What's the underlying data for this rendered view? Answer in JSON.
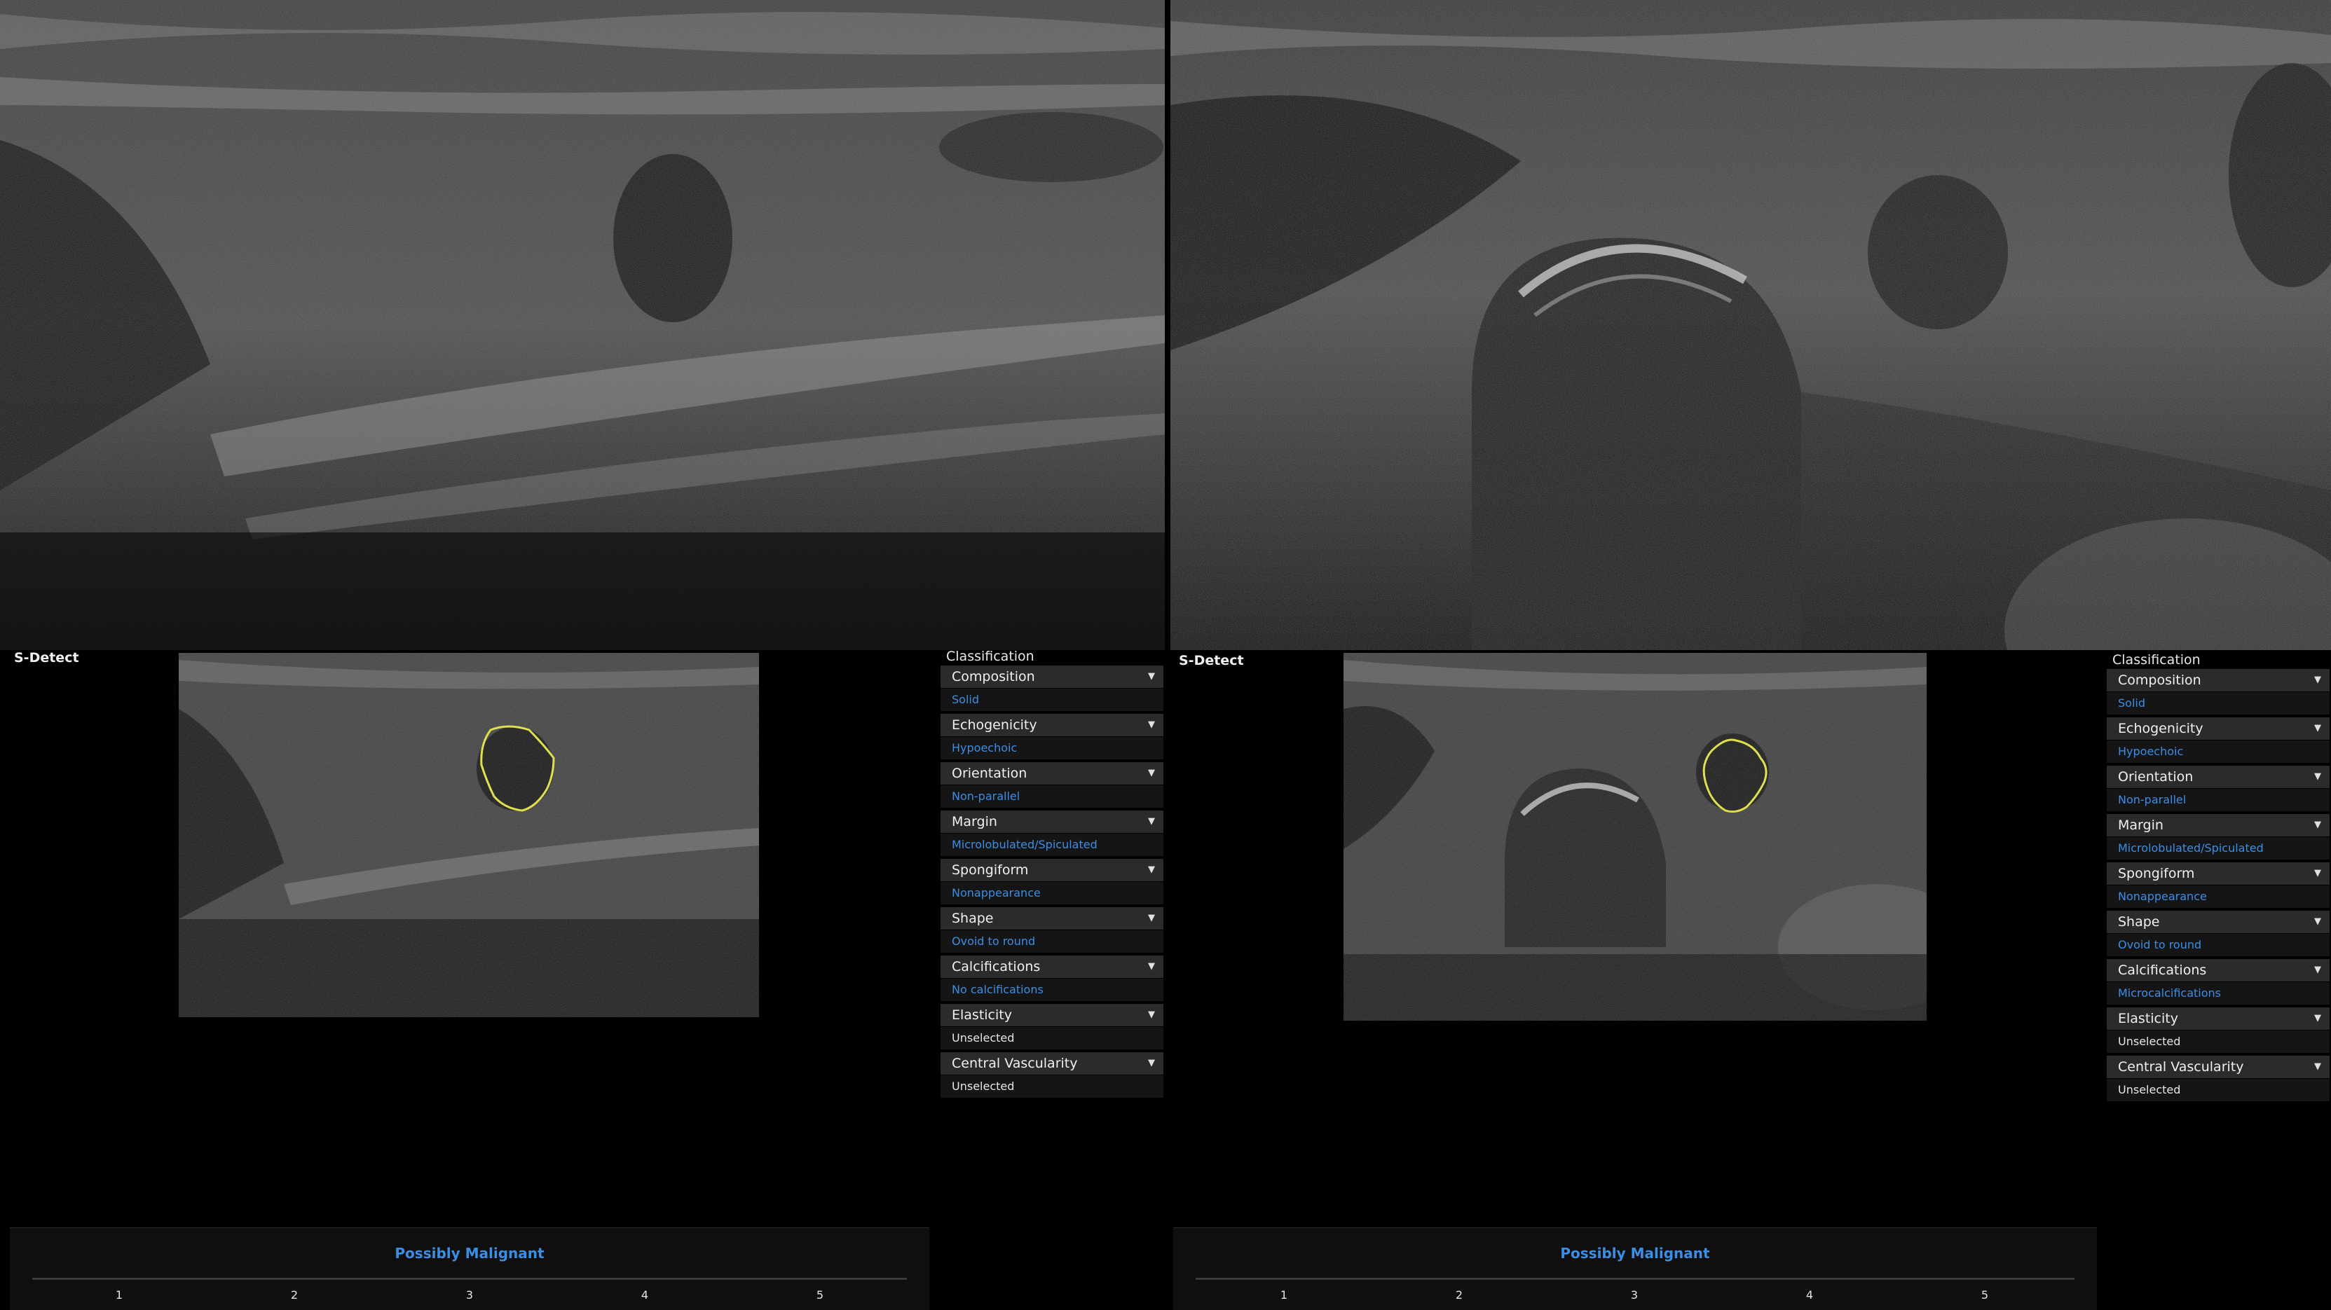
{
  "screens": [
    {
      "sdetect_label": "S-Detect",
      "classification_title": "Classification",
      "categories": [
        {
          "name": "Composition",
          "value": "Solid",
          "state": "set"
        },
        {
          "name": "Echogenicity",
          "value": "Hypoechoic",
          "state": "set"
        },
        {
          "name": "Orientation",
          "value": "Non-parallel",
          "state": "set"
        },
        {
          "name": "Margin",
          "value": "Microlobulated/Spiculated",
          "state": "set"
        },
        {
          "name": "Spongiform",
          "value": "Nonappearance",
          "state": "set"
        },
        {
          "name": "Shape",
          "value": "Ovoid to round",
          "state": "set"
        },
        {
          "name": "Calcifications",
          "value": "No calcifications",
          "state": "set"
        },
        {
          "name": "Elasticity",
          "value": "Unselected",
          "state": "unset"
        },
        {
          "name": "Central Vascularity",
          "value": "Unselected",
          "state": "unset"
        }
      ],
      "result_label": "Possibly Malignant",
      "scale": [
        "1",
        "2",
        "3",
        "4",
        "5"
      ]
    },
    {
      "sdetect_label": "S-Detect",
      "classification_title": "Classification",
      "categories": [
        {
          "name": "Composition",
          "value": "Solid",
          "state": "set"
        },
        {
          "name": "Echogenicity",
          "value": "Hypoechoic",
          "state": "set"
        },
        {
          "name": "Orientation",
          "value": "Non-parallel",
          "state": "set"
        },
        {
          "name": "Margin",
          "value": "Microlobulated/Spiculated",
          "state": "set"
        },
        {
          "name": "Spongiform",
          "value": "Nonappearance",
          "state": "set"
        },
        {
          "name": "Shape",
          "value": "Ovoid to round",
          "state": "set"
        },
        {
          "name": "Calcifications",
          "value": "Microcalcifications",
          "state": "set"
        },
        {
          "name": "Elasticity",
          "value": "Unselected",
          "state": "unset"
        },
        {
          "name": "Central Vascularity",
          "value": "Unselected",
          "state": "unset"
        }
      ],
      "result_label": "Possibly Malignant",
      "scale": [
        "1",
        "2",
        "3",
        "4",
        "5"
      ]
    }
  ],
  "colors": {
    "selected_value": "#3a8ee6",
    "lesion_outline": "#e6e63a",
    "category_header_bg": "#2b2b2b"
  },
  "icons": {
    "dropdown": "caret-down-icon"
  }
}
